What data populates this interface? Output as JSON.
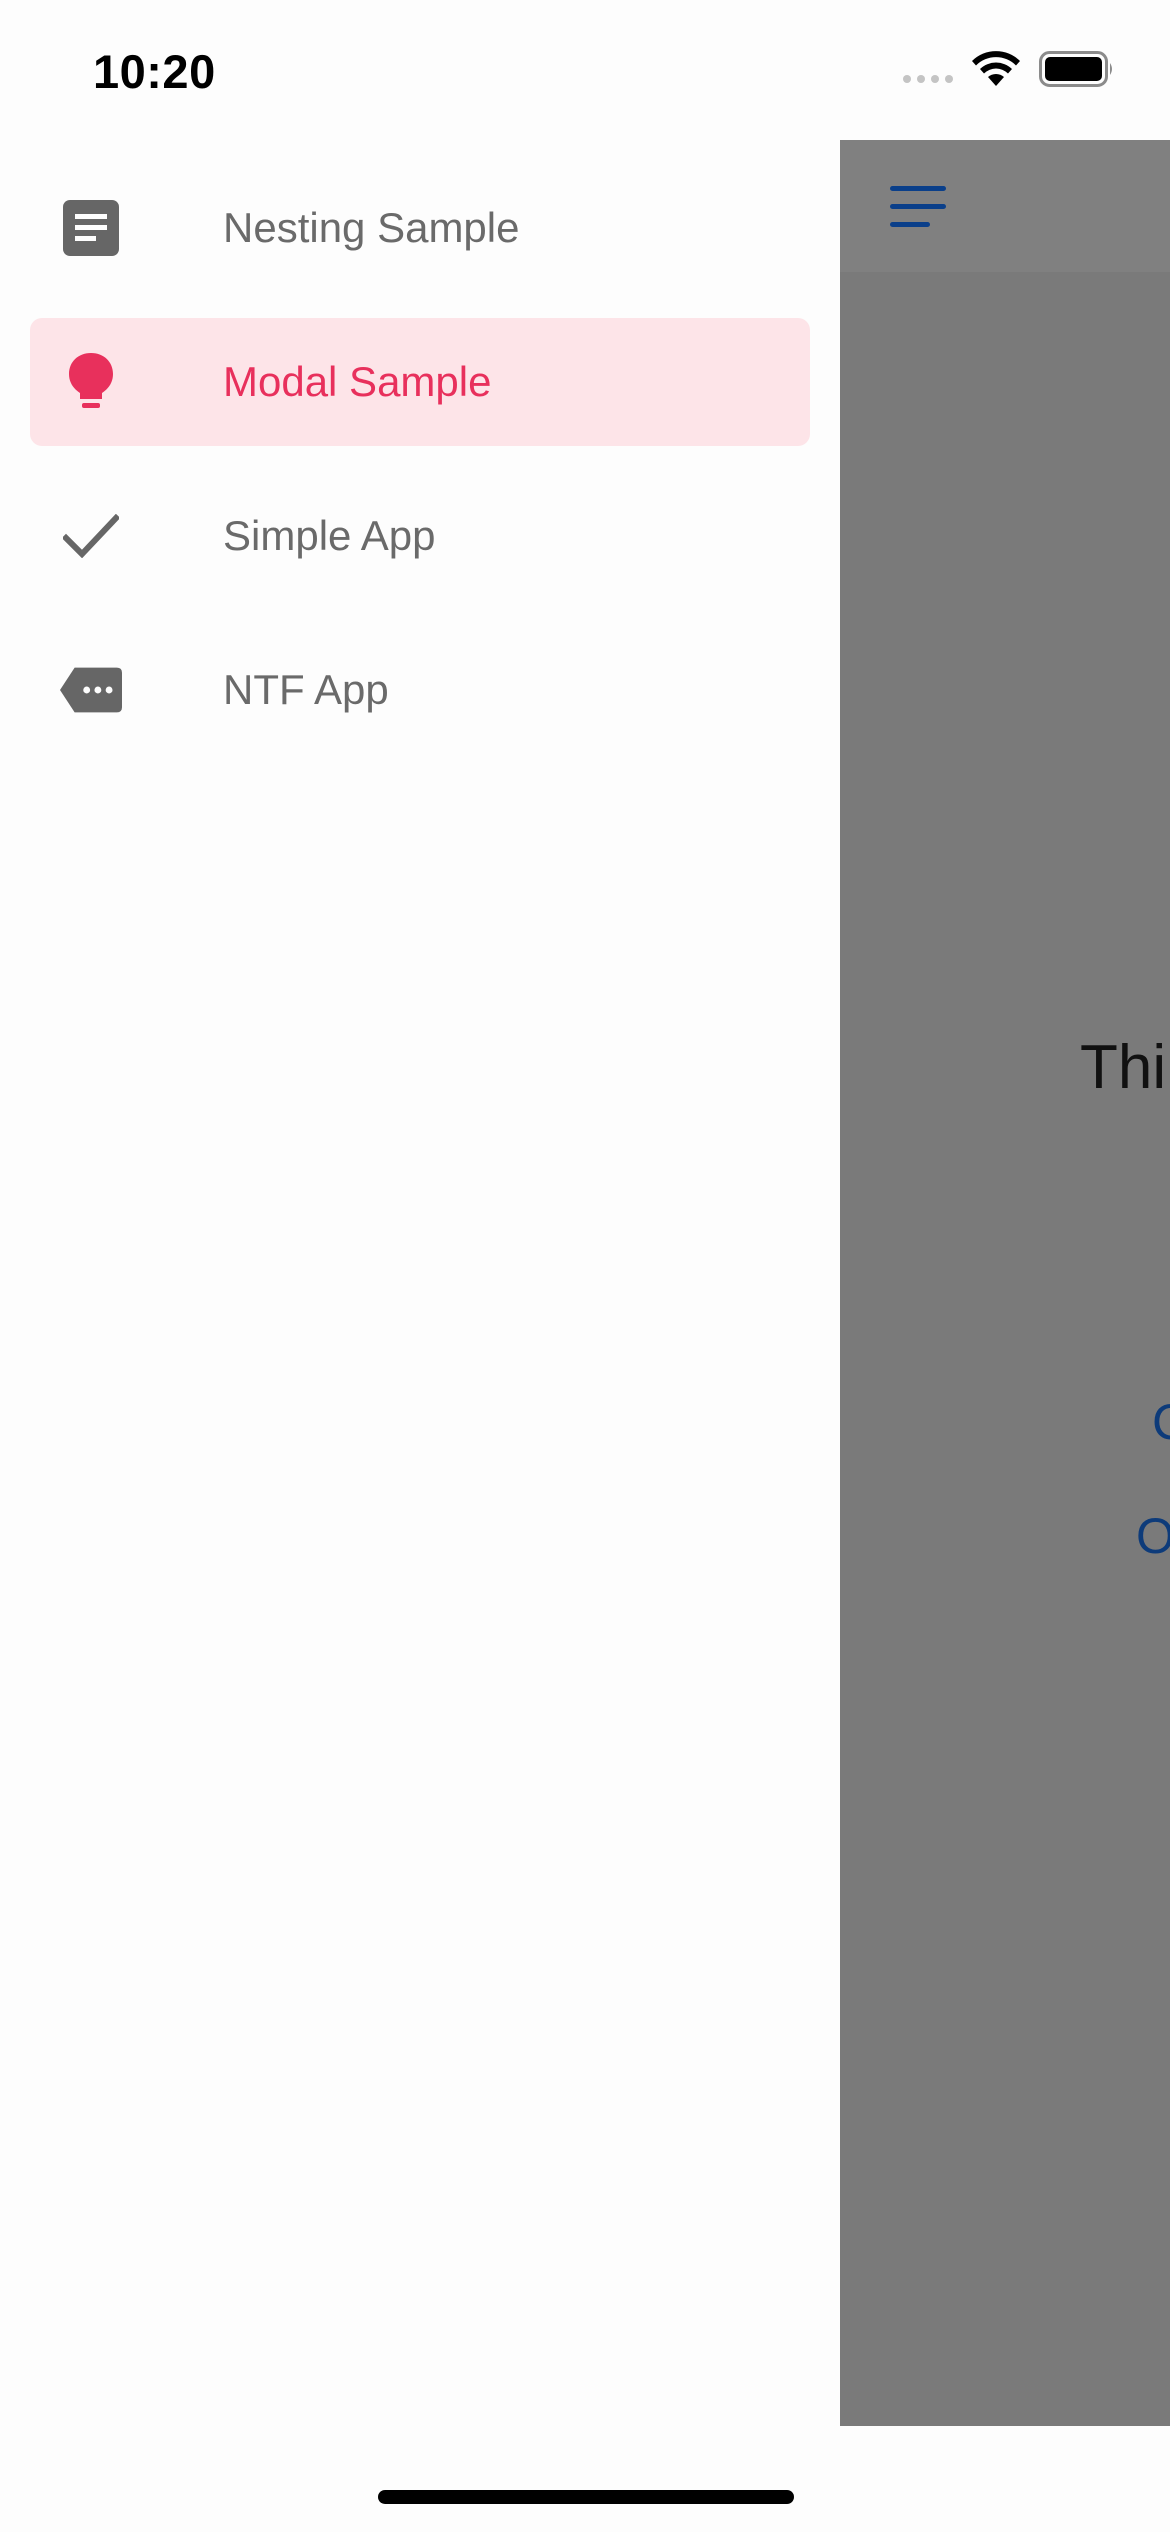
{
  "status_bar": {
    "time": "10:20"
  },
  "drawer": {
    "items": [
      {
        "label": "Nesting Sample",
        "icon": "document-icon",
        "active": false
      },
      {
        "label": "Modal Sample",
        "icon": "lightbulb-icon",
        "active": true
      },
      {
        "label": "Simple App",
        "icon": "checkmark-icon",
        "active": false
      },
      {
        "label": "NTF App",
        "icon": "label-more-icon",
        "active": false
      }
    ]
  },
  "main": {
    "partial_text": "Thi",
    "partial_link_1": "C",
    "partial_link_2": "O"
  },
  "colors": {
    "accent": "#e8305c",
    "active_bg": "#fde4e8",
    "icon_gray": "#666666",
    "overlay": "#7a7a7a",
    "link_blue": "#0d3b7a"
  }
}
